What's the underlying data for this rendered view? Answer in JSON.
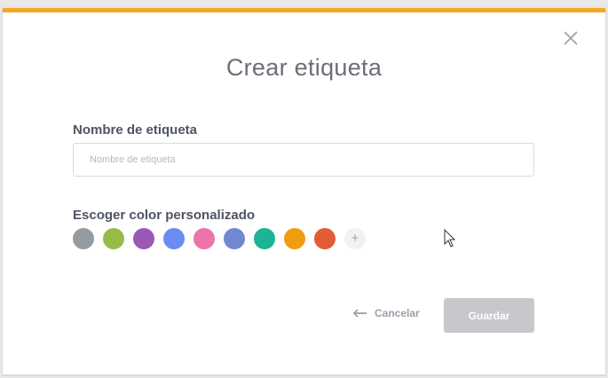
{
  "modal": {
    "title": "Crear etiqueta",
    "accent_color": "#f5a623",
    "close_icon": "close-icon"
  },
  "name_field": {
    "label": "Nombre de etiqueta",
    "placeholder": "Nombre de etiqueta",
    "value": ""
  },
  "color_picker": {
    "label": "Escoger color personalizado",
    "colors": [
      "#949ca1",
      "#97bb48",
      "#9b59b6",
      "#6b8cef",
      "#ec74a8",
      "#6f88d0",
      "#1db393",
      "#f29c11",
      "#e25c36"
    ],
    "add_label": "+"
  },
  "actions": {
    "cancel_label": "Cancelar",
    "cancel_icon": "arrow-left-icon",
    "save_label": "Guardar"
  }
}
